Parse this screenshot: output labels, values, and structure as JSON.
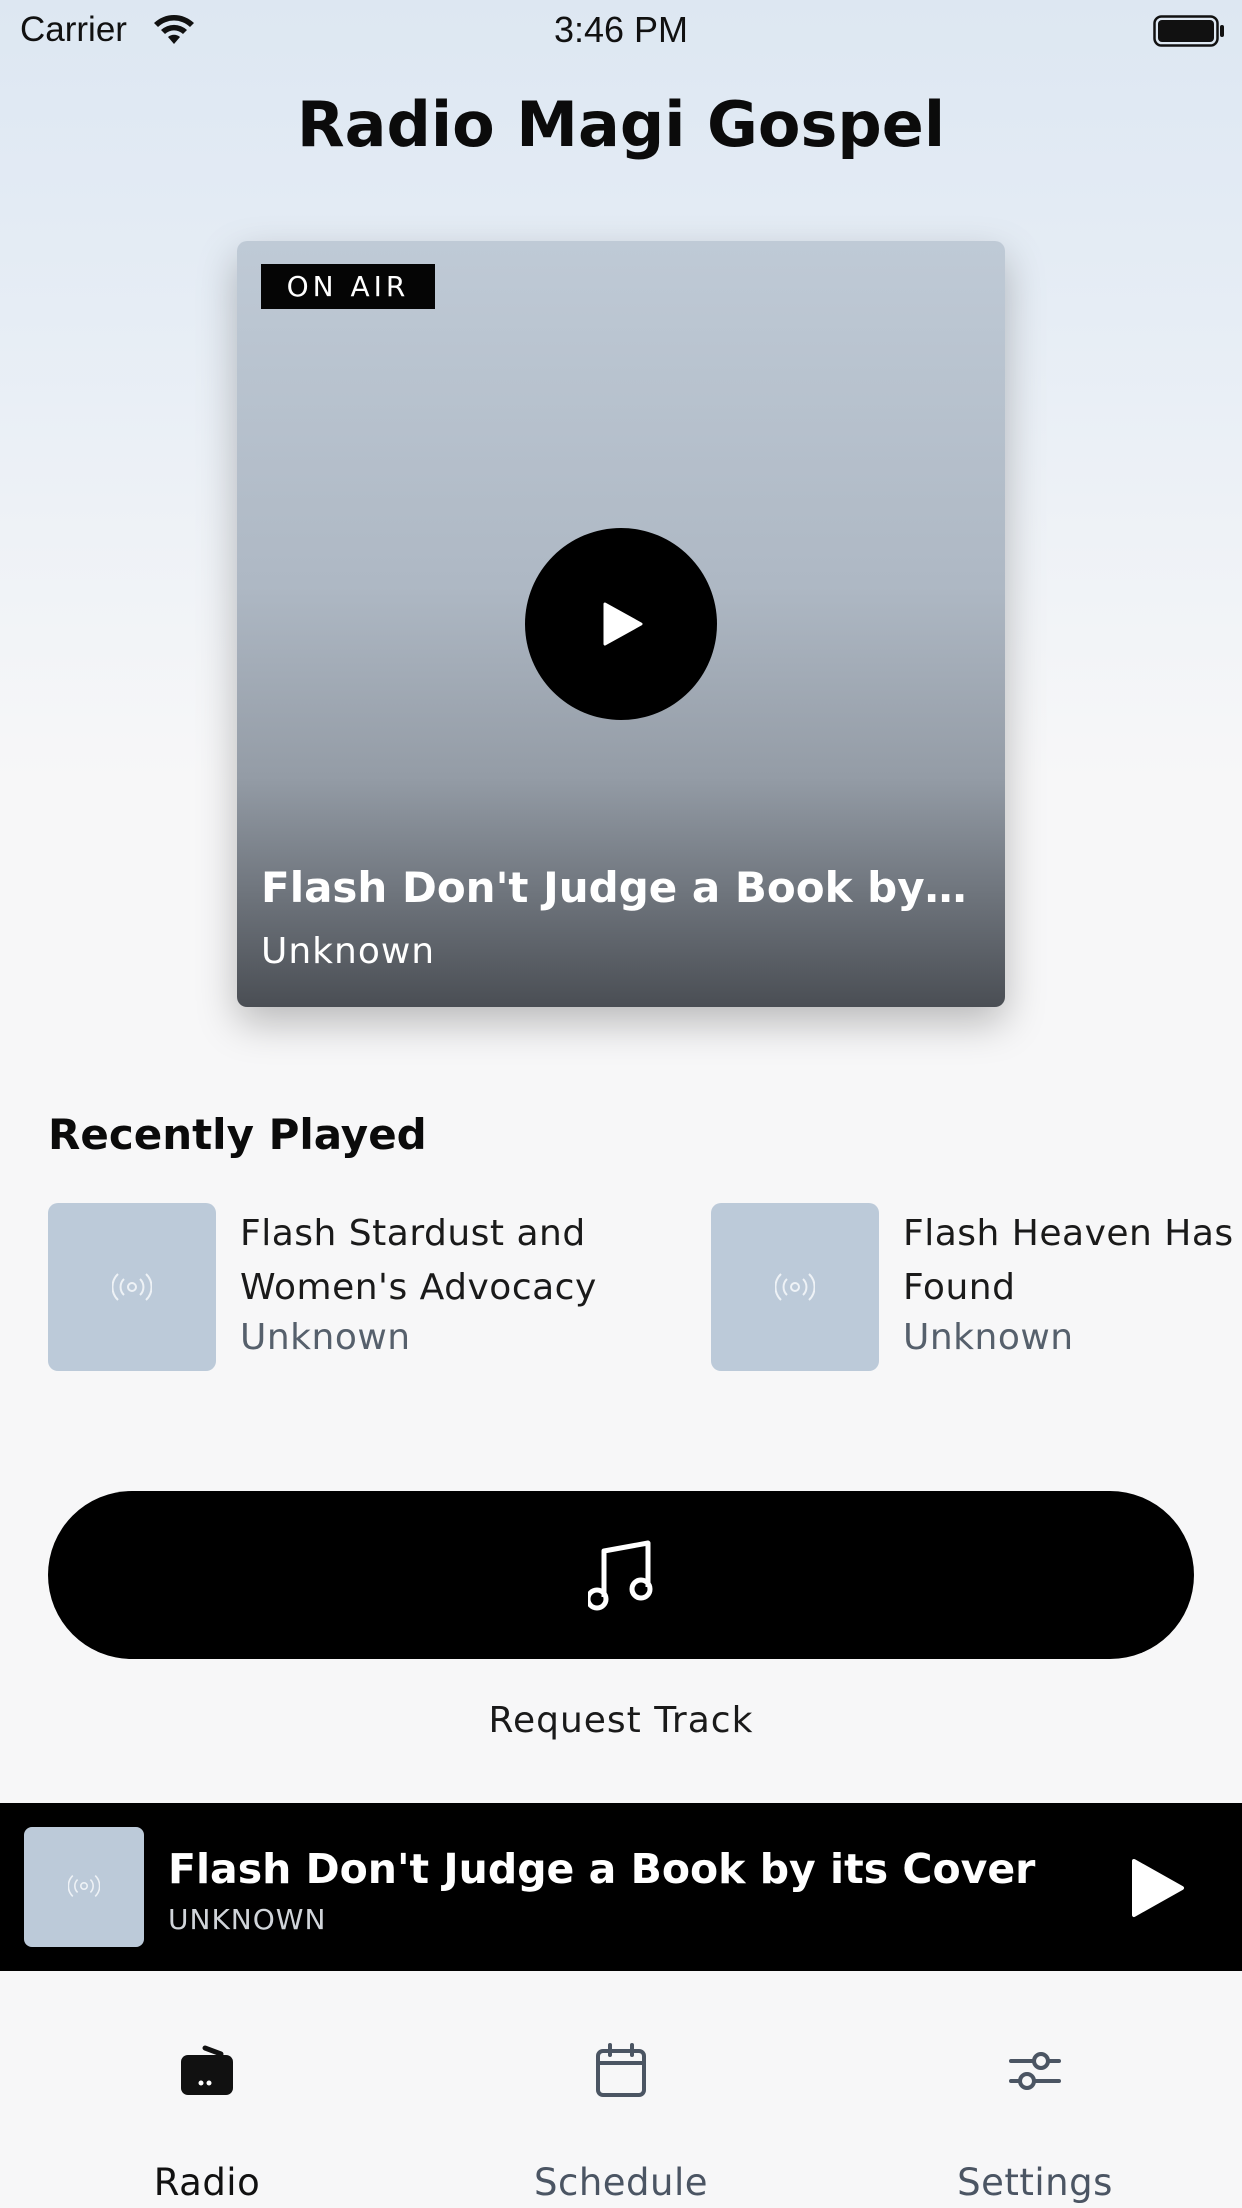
{
  "status_bar": {
    "carrier": "Carrier",
    "time": "3:46 PM",
    "wifi_icon": "wifi-icon",
    "battery_icon": "battery-icon"
  },
  "header": {
    "title": "Radio Magi Gospel"
  },
  "now_playing_card": {
    "badge": "ON AIR",
    "title": "Flash Don't Judge a Book by its...",
    "artist": "Unknown",
    "play_icon": "play-icon"
  },
  "recently_played": {
    "title": "Recently Played",
    "items": [
      {
        "title": "Flash Stardust and Women's Advocacy",
        "artist": "Unknown",
        "icon": "radio-waves-icon"
      },
      {
        "title": "Flash Heaven Has Found",
        "artist": "Unknown",
        "icon": "radio-waves-icon"
      }
    ]
  },
  "request": {
    "label": "Request Track",
    "icon": "music-note-icon"
  },
  "mini_player": {
    "title": "Flash Don't Judge a Book by its Cover",
    "artist": "UNKNOWN",
    "play_icon": "play-icon"
  },
  "tabs": [
    {
      "label": "Radio",
      "icon": "radio-icon",
      "active": true
    },
    {
      "label": "Schedule",
      "icon": "calendar-icon",
      "active": false
    },
    {
      "label": "Settings",
      "icon": "sliders-icon",
      "active": false
    }
  ],
  "colors": {
    "accent": "#000000",
    "active_tab": "#111111",
    "inactive_tab": "#4b5563",
    "thumb_placeholder": "#bccad9"
  }
}
